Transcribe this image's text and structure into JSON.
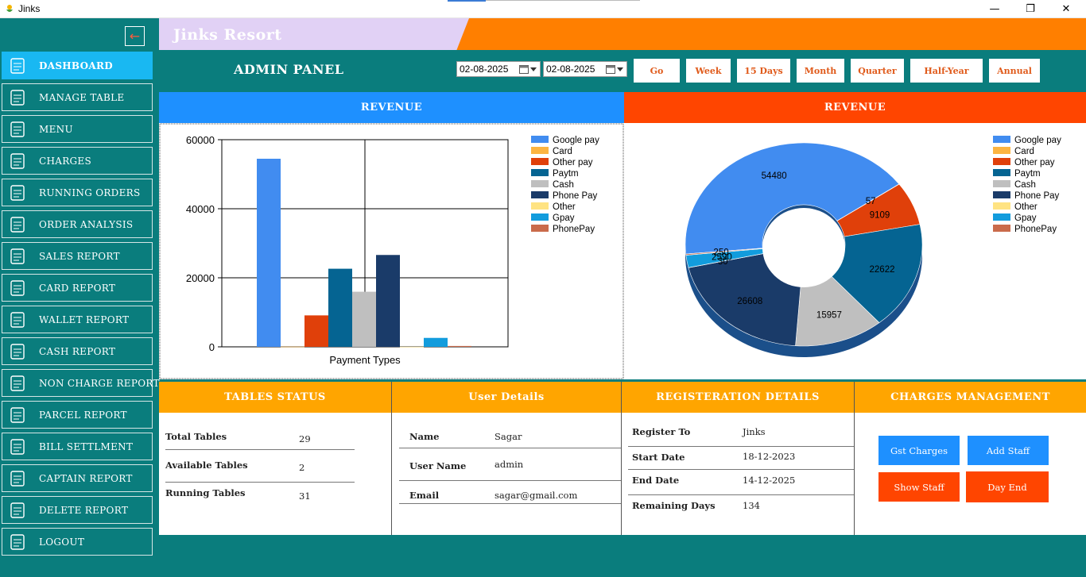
{
  "window": {
    "title": "Jinks",
    "minimize": "—",
    "maximize": "❐",
    "close": "✕"
  },
  "sidebar": {
    "back_icon": "back-arrow-icon",
    "items": [
      {
        "label": "DASHBOARD",
        "icon": "dashboard-grid-icon",
        "active": true
      },
      {
        "label": "MANAGE  TABLE",
        "icon": "table-chairs-icon"
      },
      {
        "label": "MENU",
        "icon": "menu-dish-icon"
      },
      {
        "label": "CHARGES",
        "icon": "fork-knife-icon"
      },
      {
        "label": "RUNNING ORDERS",
        "icon": "order-list-icon"
      },
      {
        "label": "ORDER ANALYSIS",
        "icon": "analysis-doc-icon"
      },
      {
        "label": "SALES REPORT",
        "icon": "sales-report-icon"
      },
      {
        "label": "CARD REPORT",
        "icon": "clipboard-icon"
      },
      {
        "label": "WALLET REPORT",
        "icon": "wallet-icon"
      },
      {
        "label": "CASH REPORT",
        "icon": "cash-doc-icon"
      },
      {
        "label": "NON CHARGE REPORT",
        "icon": "document-icon"
      },
      {
        "label": "PARCEL REPORT",
        "icon": "parcel-clipboard-icon"
      },
      {
        "label": "BILL SETTLMENT",
        "icon": "bill-icon"
      },
      {
        "label": "CAPTAIN REPORT",
        "icon": "captain-doc-icon"
      },
      {
        "label": "DELETE REPORT",
        "icon": "delete-doc-icon"
      },
      {
        "label": "LOGOUT",
        "icon": "logout-icon"
      }
    ]
  },
  "header": {
    "brand": "Jinks Resort",
    "panel_title": "ADMIN PANEL"
  },
  "filters": {
    "from_date": "02-08-2025",
    "to_date": "02-08-2025",
    "buttons": [
      "Go",
      "Week",
      "15 Days",
      "Month",
      "Quarter",
      "Half-Year",
      "Annual"
    ]
  },
  "revenue_left": {
    "title": "REVENUE",
    "color": "#1e90ff"
  },
  "revenue_right": {
    "title": "REVENUE",
    "color": "#ff4500"
  },
  "chart_data": [
    {
      "type": "bar",
      "title": "",
      "xlabel": "Payment Types",
      "ylabel": "",
      "ylim": [
        0,
        60000
      ],
      "yticks": [
        "0",
        "20000",
        "40000",
        "60000"
      ],
      "grid": true,
      "legend": "top-right",
      "categories": [
        "Google pay",
        "Card",
        "Other pay",
        "Paytm",
        "Cash",
        "Phone Pay",
        "Other",
        "Gpay",
        "PhonePay"
      ],
      "values": [
        54480,
        57,
        9109,
        22622,
        15957,
        26608,
        30,
        2590,
        250
      ],
      "colors": [
        "#418cf0",
        "#fcb441",
        "#e0400a",
        "#056492",
        "#bfbfbf",
        "#1a3b69",
        "#ffe382",
        "#129cdd",
        "#ca6b4b"
      ]
    },
    {
      "type": "pie",
      "title": "",
      "legend": "top-right",
      "categories": [
        "Google pay",
        "Card",
        "Other pay",
        "Paytm",
        "Cash",
        "Phone Pay",
        "Other",
        "Gpay",
        "PhonePay"
      ],
      "values": [
        54480,
        57,
        9109,
        22622,
        15957,
        26608,
        30,
        2590,
        250
      ],
      "labels": [
        "54480",
        "57",
        "9109",
        "22622",
        "15957",
        "26608",
        "30",
        "2590",
        "250"
      ],
      "colors": [
        "#418cf0",
        "#fcb441",
        "#e0400a",
        "#056492",
        "#bfbfbf",
        "#1a3b69",
        "#ffe382",
        "#129cdd",
        "#ca6b4b"
      ]
    }
  ],
  "tables_status": {
    "title": "TABLES STATUS",
    "rows": [
      {
        "label": "Total Tables",
        "value": "29"
      },
      {
        "label": "Available Tables",
        "value": "2"
      },
      {
        "label": "Running Tables",
        "value": "31"
      }
    ]
  },
  "user_details": {
    "title": "User Details",
    "rows": [
      {
        "label": "Name",
        "value": "Sagar"
      },
      {
        "label": "User Name",
        "value": "admin"
      },
      {
        "label": "Email",
        "value": "sagar@gmail.com"
      }
    ]
  },
  "registration": {
    "title": "REGISTERATION DETAILS",
    "rows": [
      {
        "label": "Register To",
        "value": "Jinks"
      },
      {
        "label": "Start Date",
        "value": "18-12-2023"
      },
      {
        "label": "End Date",
        "value": "14-12-2025"
      },
      {
        "label": "Remaining Days",
        "value": "134"
      }
    ]
  },
  "charges": {
    "title": "CHARGES MANAGEMENT",
    "gst": "Gst Charges",
    "add_staff": "Add Staff",
    "show_staff": "Show Staff",
    "day_end": "Day End",
    "blue": "#1e90ff",
    "red": "#ff4500"
  },
  "colors": {
    "teal": "#0a7d7d",
    "orange_head": "#ffa500",
    "brand_orange": "#ff7f00",
    "active_nav": "#19b8f2"
  }
}
